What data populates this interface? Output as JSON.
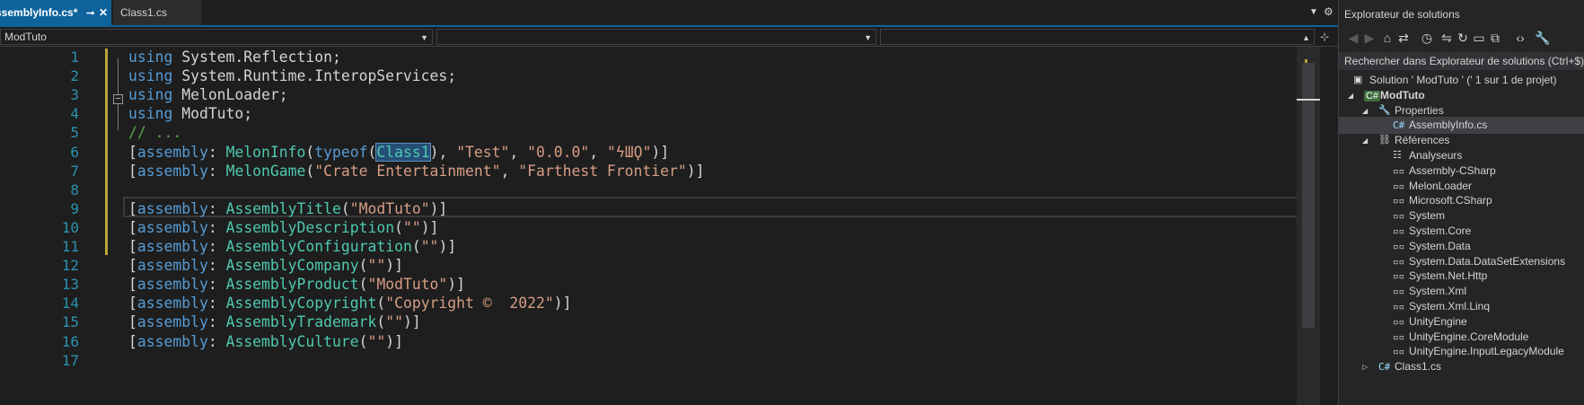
{
  "tabs": [
    {
      "label": "ssemblyInfo.cs*",
      "pinned_icon": "pin-icon",
      "close_icon": "close-icon",
      "active": true
    },
    {
      "label": "Class1.cs",
      "active": false
    }
  ],
  "navbar": {
    "project": "ModTuto",
    "type": "",
    "member": ""
  },
  "code": {
    "line_numbers": [
      "1",
      "2",
      "3",
      "4",
      "5",
      "6",
      "7",
      "8",
      "9",
      "10",
      "11",
      "12",
      "13",
      "14",
      "15",
      "16",
      "17"
    ],
    "lines": [
      [
        {
          "c": "kw",
          "t": "using"
        },
        {
          "c": "pn",
          "t": " System.Reflection;"
        }
      ],
      [
        {
          "c": "kw",
          "t": "using"
        },
        {
          "c": "pn",
          "t": " System.Runtime.InteropServices;"
        }
      ],
      [
        {
          "c": "kw",
          "t": "using"
        },
        {
          "c": "pn",
          "t": " MelonLoader;"
        }
      ],
      [
        {
          "c": "kw",
          "t": "using"
        },
        {
          "c": "pn",
          "t": " ModTuto;"
        }
      ],
      [
        {
          "c": "cm",
          "t": "// ..."
        }
      ],
      [
        {
          "c": "pn",
          "t": "["
        },
        {
          "c": "kw",
          "t": "assembly"
        },
        {
          "c": "pn",
          "t": ": "
        },
        {
          "c": "ty",
          "t": "MelonInfo"
        },
        {
          "c": "pn",
          "t": "("
        },
        {
          "c": "kw",
          "t": "typeof"
        },
        {
          "c": "pn",
          "t": "("
        },
        {
          "c": "ty sel",
          "t": "Class1"
        },
        {
          "c": "pn",
          "t": "), "
        },
        {
          "c": "st",
          "t": "\"Test\""
        },
        {
          "c": "pn",
          "t": ", "
        },
        {
          "c": "st",
          "t": "\"0.0.0\""
        },
        {
          "c": "pn",
          "t": ", "
        },
        {
          "c": "st",
          "t": "\"ϟШϘ\""
        },
        {
          "c": "pn",
          "t": ")]"
        }
      ],
      [
        {
          "c": "pn",
          "t": "["
        },
        {
          "c": "kw",
          "t": "assembly"
        },
        {
          "c": "pn",
          "t": ": "
        },
        {
          "c": "ty",
          "t": "MelonGame"
        },
        {
          "c": "pn",
          "t": "("
        },
        {
          "c": "st",
          "t": "\"Crate Entertainment\""
        },
        {
          "c": "pn",
          "t": ", "
        },
        {
          "c": "st",
          "t": "\"Farthest Frontier\""
        },
        {
          "c": "pn",
          "t": ")]"
        }
      ],
      [],
      [
        {
          "c": "pn",
          "t": "["
        },
        {
          "c": "kw",
          "t": "assembly"
        },
        {
          "c": "pn",
          "t": ": "
        },
        {
          "c": "ty",
          "t": "AssemblyTitle"
        },
        {
          "c": "pn",
          "t": "("
        },
        {
          "c": "st",
          "t": "\"ModTuto\""
        },
        {
          "c": "pn",
          "t": ")]"
        }
      ],
      [
        {
          "c": "pn",
          "t": "["
        },
        {
          "c": "kw",
          "t": "assembly"
        },
        {
          "c": "pn",
          "t": ": "
        },
        {
          "c": "ty",
          "t": "AssemblyDescription"
        },
        {
          "c": "pn",
          "t": "("
        },
        {
          "c": "st",
          "t": "\"\""
        },
        {
          "c": "pn",
          "t": ")]"
        }
      ],
      [
        {
          "c": "pn",
          "t": "["
        },
        {
          "c": "kw",
          "t": "assembly"
        },
        {
          "c": "pn",
          "t": ": "
        },
        {
          "c": "ty",
          "t": "AssemblyConfiguration"
        },
        {
          "c": "pn",
          "t": "("
        },
        {
          "c": "st",
          "t": "\"\""
        },
        {
          "c": "pn",
          "t": ")]"
        }
      ],
      [
        {
          "c": "pn",
          "t": "["
        },
        {
          "c": "kw",
          "t": "assembly"
        },
        {
          "c": "pn",
          "t": ": "
        },
        {
          "c": "ty",
          "t": "AssemblyCompany"
        },
        {
          "c": "pn",
          "t": "("
        },
        {
          "c": "st",
          "t": "\"\""
        },
        {
          "c": "pn",
          "t": ")]"
        }
      ],
      [
        {
          "c": "pn",
          "t": "["
        },
        {
          "c": "kw",
          "t": "assembly"
        },
        {
          "c": "pn",
          "t": ": "
        },
        {
          "c": "ty",
          "t": "AssemblyProduct"
        },
        {
          "c": "pn",
          "t": "("
        },
        {
          "c": "st",
          "t": "\"ModTuto\""
        },
        {
          "c": "pn",
          "t": ")]"
        }
      ],
      [
        {
          "c": "pn",
          "t": "["
        },
        {
          "c": "kw",
          "t": "assembly"
        },
        {
          "c": "pn",
          "t": ": "
        },
        {
          "c": "ty",
          "t": "AssemblyCopyright"
        },
        {
          "c": "pn",
          "t": "("
        },
        {
          "c": "st",
          "t": "\"Copyright ©  2022\""
        },
        {
          "c": "pn",
          "t": ")]"
        }
      ],
      [
        {
          "c": "pn",
          "t": "["
        },
        {
          "c": "kw",
          "t": "assembly"
        },
        {
          "c": "pn",
          "t": ": "
        },
        {
          "c": "ty",
          "t": "AssemblyTrademark"
        },
        {
          "c": "pn",
          "t": "("
        },
        {
          "c": "st",
          "t": "\"\""
        },
        {
          "c": "pn",
          "t": ")]"
        }
      ],
      [
        {
          "c": "pn",
          "t": "["
        },
        {
          "c": "kw",
          "t": "assembly"
        },
        {
          "c": "pn",
          "t": ": "
        },
        {
          "c": "ty",
          "t": "AssemblyCulture"
        },
        {
          "c": "pn",
          "t": "("
        },
        {
          "c": "st",
          "t": "\"\""
        },
        {
          "c": "pn",
          "t": ")]"
        }
      ],
      []
    ]
  },
  "solution_explorer": {
    "title": "Explorateur de solutions",
    "search_placeholder": "Rechercher dans Explorateur de solutions (Ctrl+$)",
    "toolbar_icons": [
      "back-icon",
      "forward-icon",
      "home-icon",
      "switch-views-icon",
      "history-icon",
      "sync-icon",
      "refresh-icon",
      "collapse-all-icon",
      "show-all-files-icon",
      "code-view-icon",
      "wrench-icon"
    ],
    "tree": [
      {
        "label": "Solution ' ModTuto ' (' 1 sur 1 de projet)",
        "icon": "solution-icon",
        "arrow": "",
        "level": 0
      },
      {
        "label": "ModTuto",
        "icon": "csharp-project-icon",
        "arrow": "expanded",
        "level": 1,
        "bold": true
      },
      {
        "label": "Properties",
        "icon": "wrench-icon",
        "arrow": "expanded",
        "level": 2
      },
      {
        "label": "AssemblyInfo.cs",
        "icon": "csharp-file-icon",
        "arrow": "",
        "level": 3,
        "selected": true
      },
      {
        "label": "Références",
        "icon": "references-icon",
        "arrow": "expanded",
        "level": 2
      },
      {
        "label": "Analyseurs",
        "icon": "analyzers-icon",
        "arrow": "",
        "level": 3
      },
      {
        "label": "Assembly-CSharp",
        "icon": "reference-icon",
        "arrow": "",
        "level": 3
      },
      {
        "label": "MelonLoader",
        "icon": "reference-icon",
        "arrow": "",
        "level": 3
      },
      {
        "label": "Microsoft.CSharp",
        "icon": "reference-icon",
        "arrow": "",
        "level": 3
      },
      {
        "label": "System",
        "icon": "reference-icon",
        "arrow": "",
        "level": 3
      },
      {
        "label": "System.Core",
        "icon": "reference-icon",
        "arrow": "",
        "level": 3
      },
      {
        "label": "System.Data",
        "icon": "reference-icon",
        "arrow": "",
        "level": 3
      },
      {
        "label": "System.Data.DataSetExtensions",
        "icon": "reference-icon",
        "arrow": "",
        "level": 3
      },
      {
        "label": "System.Net.Http",
        "icon": "reference-icon",
        "arrow": "",
        "level": 3
      },
      {
        "label": "System.Xml",
        "icon": "reference-icon",
        "arrow": "",
        "level": 3
      },
      {
        "label": "System.Xml.Linq",
        "icon": "reference-icon",
        "arrow": "",
        "level": 3
      },
      {
        "label": "UnityEngine",
        "icon": "reference-icon",
        "arrow": "",
        "level": 3
      },
      {
        "label": "UnityEngine.CoreModule",
        "icon": "reference-icon",
        "arrow": "",
        "level": 3
      },
      {
        "label": "UnityEngine.InputLegacyModule",
        "icon": "reference-icon",
        "arrow": "",
        "level": 3
      },
      {
        "label": "Class1.cs",
        "icon": "csharp-file-icon",
        "arrow": "collapsed",
        "level": 2
      }
    ]
  }
}
